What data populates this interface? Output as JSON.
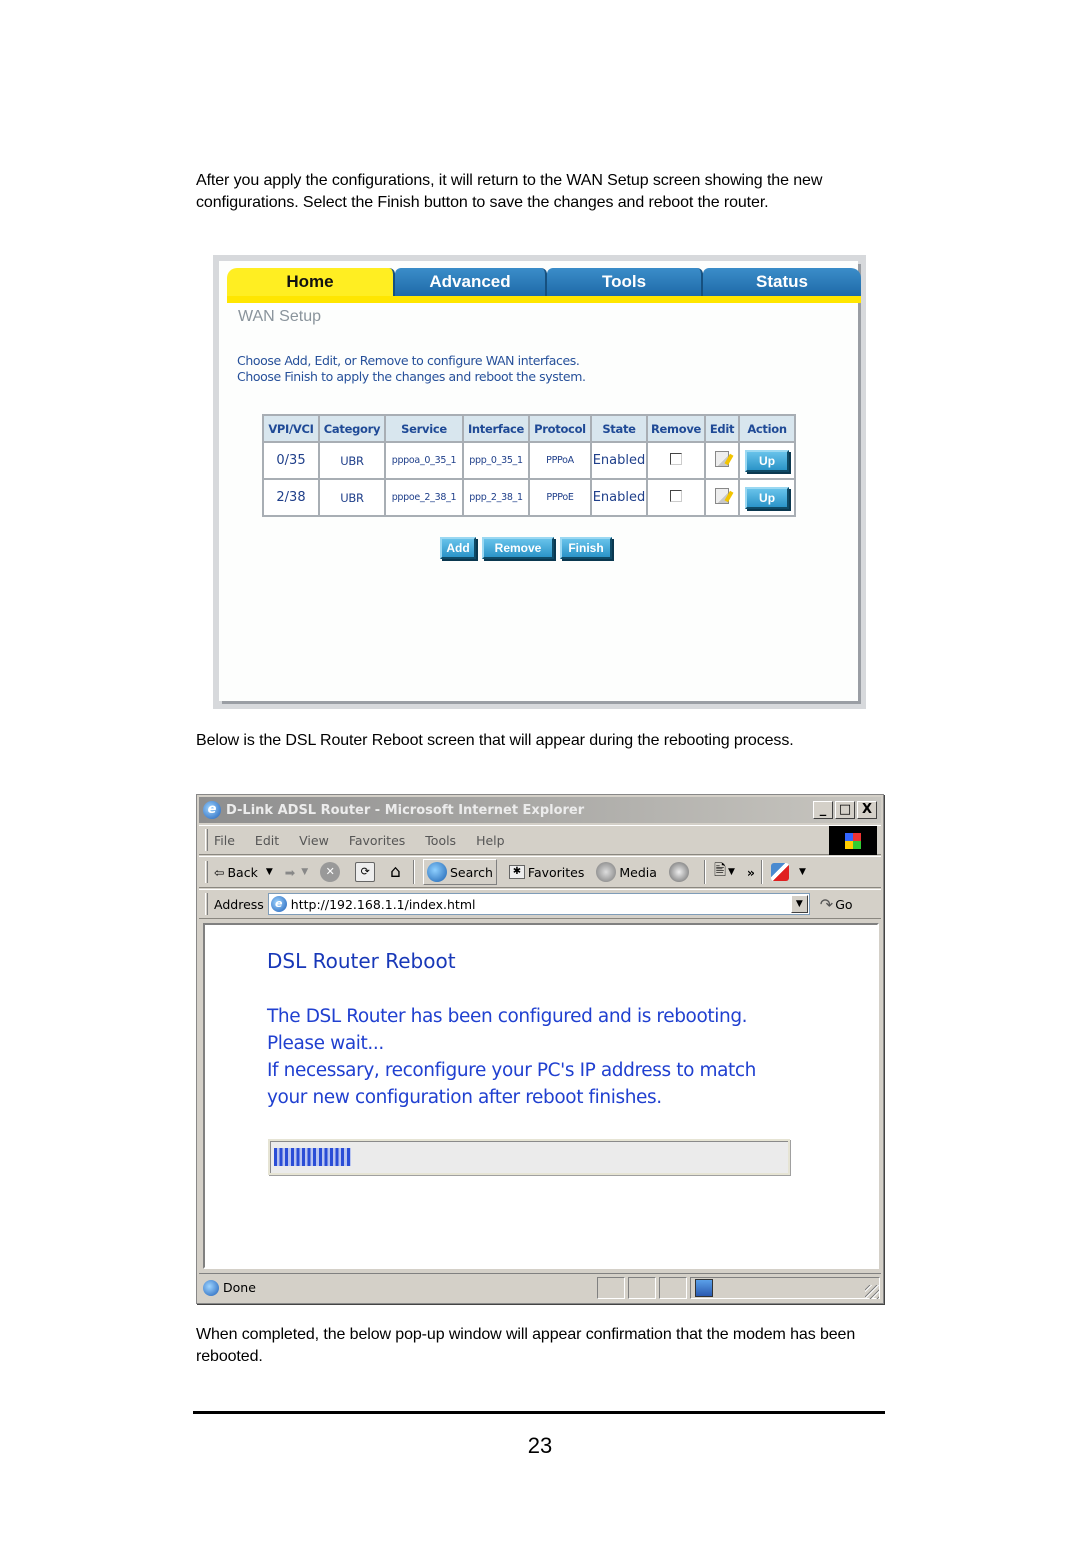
{
  "paragraphs": {
    "intro": "After you apply the configurations, it will return to the WAN Setup screen showing the new configurations.  Select the Finish button to save the changes and reboot the router.",
    "reboot_intro": "Below is the DSL Router Reboot screen that will appear during the rebooting process.",
    "completion": "When completed, the below pop-up window will appear confirmation that the modem has been rebooted."
  },
  "wan_screen": {
    "tabs": [
      {
        "label": "Home",
        "active": true
      },
      {
        "label": "Advanced",
        "active": false
      },
      {
        "label": "Tools",
        "active": false
      },
      {
        "label": "Status",
        "active": false
      }
    ],
    "title": "WAN Setup",
    "description_line1": "Choose Add, Edit, or Remove to configure WAN interfaces.",
    "description_line2": "Choose Finish to apply the changes and reboot the system.",
    "table": {
      "columns": [
        "VPI/VCI",
        "Category",
        "Service",
        "Interface",
        "Protocol",
        "State",
        "Remove",
        "Edit",
        "Action"
      ],
      "rows": [
        {
          "vpi_vci": "0/35",
          "category": "UBR",
          "service": "pppoa_0_35_1",
          "interface": "ppp_0_35_1",
          "protocol": "PPPoA",
          "state": "Enabled",
          "remove_checked": false,
          "action": "Up"
        },
        {
          "vpi_vci": "2/38",
          "category": "UBR",
          "service": "pppoe_2_38_1",
          "interface": "ppp_2_38_1",
          "protocol": "PPPoE",
          "state": "Enabled",
          "remove_checked": false,
          "action": "Up"
        }
      ]
    },
    "buttons": {
      "add": "Add",
      "remove": "Remove",
      "finish": "Finish"
    },
    "colors": {
      "tab_active": "#ffee22",
      "tab_inactive": "#2a7ab8",
      "text_blue": "#26509a"
    }
  },
  "ie_window": {
    "title": "D-Link ADSL Router - Microsoft Internet Explorer",
    "window_buttons": {
      "minimize": "_",
      "maximize": "□",
      "close": "X"
    },
    "menu": [
      "File",
      "Edit",
      "View",
      "Favorites",
      "Tools",
      "Help"
    ],
    "toolbar": {
      "back": "Back",
      "search": "Search",
      "favorites": "Favorites",
      "media": "Media",
      "chevron": "»"
    },
    "address": {
      "label": "Address",
      "url": "http://192.168.1.1/index.html",
      "go": "Go"
    },
    "page": {
      "title": "DSL Router Reboot",
      "message_lines": [
        "The DSL Router has been configured and is rebooting.",
        "Please wait...",
        "If necessary, reconfigure your PC's IP address to match",
        "your new configuration after reboot finishes."
      ],
      "progress_percent": 15
    },
    "status": "Done",
    "colors": {
      "page_text": "#2040d0",
      "progress_fill": "#2a4dd6"
    }
  },
  "footer": {
    "page_number": "23"
  }
}
